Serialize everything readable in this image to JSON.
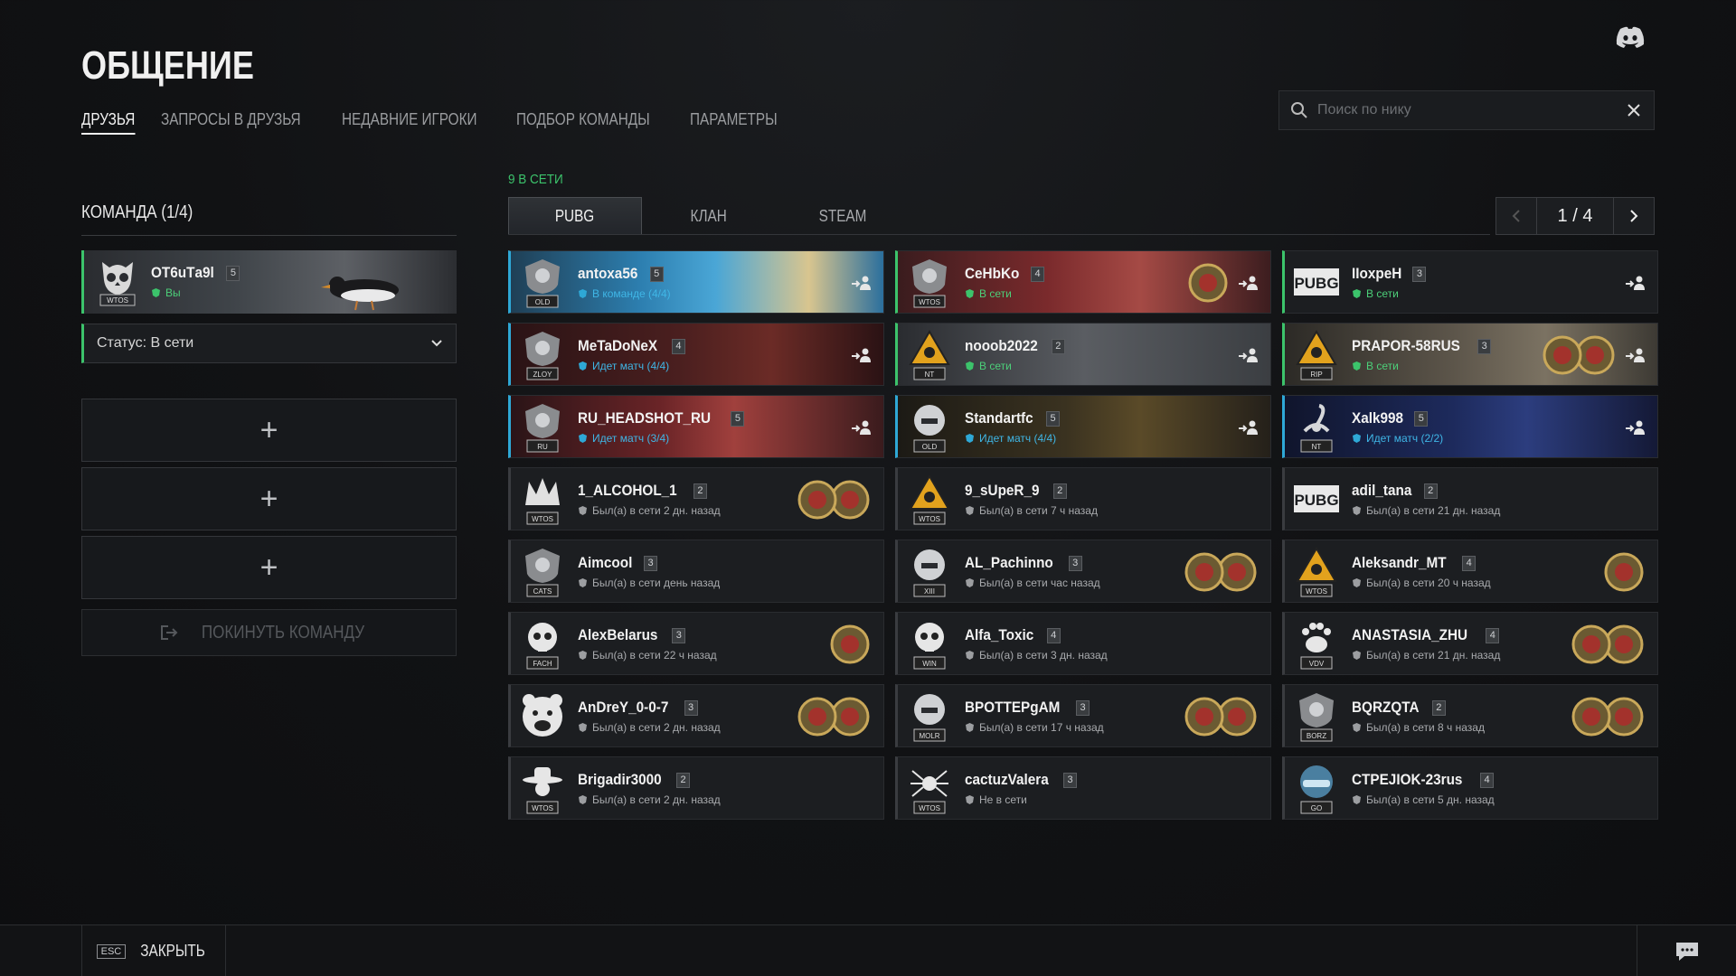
{
  "header": {
    "title": "ОБЩЕНИЕ",
    "tabs": [
      {
        "label": "ДРУЗЬЯ",
        "active": true
      },
      {
        "label": "ЗАПРОСЫ В ДРУЗЬЯ",
        "active": false
      },
      {
        "label": "НЕДАВНИЕ ИГРОКИ",
        "active": false
      },
      {
        "label": "ПОДБОР КОМАНДЫ",
        "active": false
      },
      {
        "label": "ПАРАМЕТРЫ",
        "active": false
      }
    ],
    "search_placeholder": "Поиск по нику"
  },
  "team": {
    "title": "КОМАНДА (1/4)",
    "member": {
      "nick": "ОТ6uТa9l",
      "level": "5",
      "status": "Вы",
      "emblem": "WTOS"
    },
    "status_select": "Статус: В сети",
    "empty_slot_symbol": "+",
    "leave_label": "ПОКИНУТЬ КОМАНДУ"
  },
  "friends": {
    "online_count": "9 В СЕТИ",
    "tabs": [
      {
        "label": "PUBG",
        "active": true
      },
      {
        "label": "КЛАН",
        "active": false
      },
      {
        "label": "STEAM",
        "active": false
      }
    ],
    "page": "1 / 4",
    "cards": [
      {
        "nick": "antoxa56",
        "level": "5",
        "status": "В команде (4/4)",
        "state": "ingame",
        "emblem": "OLD",
        "icon": "clan-shield-icon",
        "theme": "beach",
        "invite": true,
        "medals": 0
      },
      {
        "nick": "CeHbKo",
        "level": "4",
        "status": "В сети",
        "state": "online",
        "emblem": "WTOS",
        "icon": "clan-shield-icon",
        "theme": "redcity",
        "invite": true,
        "medals": 1
      },
      {
        "nick": "IIoxpeH",
        "level": "3",
        "status": "В сети",
        "state": "online",
        "emblem": "",
        "icon": "pubg-logo-icon",
        "theme": "plain",
        "invite": true,
        "medals": 0
      },
      {
        "nick": "MeTaDoNeX",
        "level": "4",
        "status": "Идет матч (4/4)",
        "state": "ingame",
        "emblem": "ZLOY",
        "icon": "clan-shield-icon",
        "theme": "darkred",
        "invite": true,
        "medals": 0
      },
      {
        "nick": "nooob2022",
        "level": "2",
        "status": "В сети",
        "state": "online",
        "emblem": "NT",
        "icon": "biohazard-icon",
        "theme": "grey",
        "invite": true,
        "medals": 0
      },
      {
        "nick": "PRAPOR-58RUS",
        "level": "3",
        "status": "В сети",
        "state": "online",
        "emblem": "RIP",
        "icon": "biohazard-icon",
        "theme": "sand",
        "invite": true,
        "medals": 2
      },
      {
        "nick": "RU_HEADSHOT_RU",
        "level": "5",
        "status": "Идет матч (3/4)",
        "state": "ingame",
        "emblem": "RU",
        "icon": "clan-shield-icon",
        "theme": "crimson",
        "invite": true,
        "medals": 0
      },
      {
        "nick": "Standartfc",
        "level": "5",
        "status": "Идет матч (4/4)",
        "state": "ingame",
        "emblem": "OLD",
        "icon": "helmet-icon",
        "theme": "gold",
        "invite": true,
        "medals": 0
      },
      {
        "nick": "Xalk998",
        "level": "5",
        "status": "Идет матч (2/2)",
        "state": "ingame",
        "emblem": "NT",
        "icon": "scorpion-icon",
        "theme": "blue",
        "invite": true,
        "medals": 0
      },
      {
        "nick": "1_ALCOHOL_1",
        "level": "2",
        "status": "Был(а) в сети 2 дн. назад",
        "state": "offline",
        "emblem": "WTOS",
        "icon": "crown-icon",
        "theme": "dark",
        "invite": false,
        "medals": 2
      },
      {
        "nick": "9_sUpeR_9",
        "level": "2",
        "status": "Был(а) в сети 7 ч назад",
        "state": "offline",
        "emblem": "WTOS",
        "icon": "biohazard-icon",
        "theme": "dark",
        "invite": false,
        "medals": 0
      },
      {
        "nick": "adil_tana",
        "level": "2",
        "status": "Был(а) в сети 21 дн. назад",
        "state": "offline",
        "emblem": "",
        "icon": "pubg-logo-icon",
        "theme": "dark",
        "invite": false,
        "medals": 0
      },
      {
        "nick": "Aimcool",
        "level": "3",
        "status": "Был(а) в сети день назад",
        "state": "offline",
        "emblem": "CATS",
        "icon": "clan-shield-icon",
        "theme": "dark",
        "invite": false,
        "medals": 0
      },
      {
        "nick": "AL_Pachinno",
        "level": "3",
        "status": "Был(а) в сети час назад",
        "state": "offline",
        "emblem": "XIII",
        "icon": "helmet-icon",
        "theme": "dark",
        "invite": false,
        "medals": 2
      },
      {
        "nick": "Aleksandr_MT",
        "level": "4",
        "status": "Был(а) в сети 20 ч назад",
        "state": "offline",
        "emblem": "WTOS",
        "icon": "biohazard-icon",
        "theme": "dark",
        "invite": false,
        "medals": 1
      },
      {
        "nick": "AlexBelarus",
        "level": "3",
        "status": "Был(а) в сети 22 ч назад",
        "state": "offline",
        "emblem": "FACH",
        "icon": "skull-icon",
        "theme": "dark",
        "invite": false,
        "medals": 1
      },
      {
        "nick": "Alfa_Toxic",
        "level": "4",
        "status": "Был(а) в сети 3 дн. назад",
        "state": "offline",
        "emblem": "WIN",
        "icon": "skull-icon",
        "theme": "dark",
        "invite": false,
        "medals": 0
      },
      {
        "nick": "ANASTASIA_ZHU",
        "level": "4",
        "status": "Был(а) в сети 21 дн. назад",
        "state": "offline",
        "emblem": "VDV",
        "icon": "paw-icon",
        "theme": "dark",
        "invite": false,
        "medals": 2
      },
      {
        "nick": "AnDreY_0-0-7",
        "level": "3",
        "status": "Был(а) в сети 2 дн. назад",
        "state": "offline",
        "emblem": "",
        "icon": "bear-icon",
        "theme": "dark",
        "invite": false,
        "medals": 2
      },
      {
        "nick": "BPOTTEPgAM",
        "level": "3",
        "status": "Был(а) в сети 17 ч назад",
        "state": "offline",
        "emblem": "MOLR",
        "icon": "helmet-icon",
        "theme": "dark",
        "invite": false,
        "medals": 2
      },
      {
        "nick": "BQRZQTA",
        "level": "2",
        "status": "Был(а) в сети 8 ч назад",
        "state": "offline",
        "emblem": "BORZ",
        "icon": "clan-shield-icon",
        "theme": "dark",
        "invite": false,
        "medals": 2
      },
      {
        "nick": "Brigadir3000",
        "level": "2",
        "status": "Был(а) в сети 2 дн. назад",
        "state": "offline",
        "emblem": "WTOS",
        "icon": "cowboy-icon",
        "theme": "dark",
        "invite": false,
        "medals": 0
      },
      {
        "nick": "cactuzValera",
        "level": "3",
        "status": "Не в сети",
        "state": "offline",
        "emblem": "WTOS",
        "icon": "spider-icon",
        "theme": "dark",
        "invite": false,
        "medals": 0
      },
      {
        "nick": "CTPEJIOK-23rus",
        "level": "4",
        "status": "Был(а) в сети 5 дн. назад",
        "state": "offline",
        "emblem": "GO",
        "icon": "car-icon",
        "theme": "dark",
        "invite": false,
        "medals": 0
      }
    ]
  },
  "footer": {
    "esc_key": "ESC",
    "close_label": "ЗАКРЫТЬ"
  },
  "colors": {
    "online": "#3cc36b",
    "ingame": "#2ea8d6",
    "offline": "#3a3c40"
  }
}
